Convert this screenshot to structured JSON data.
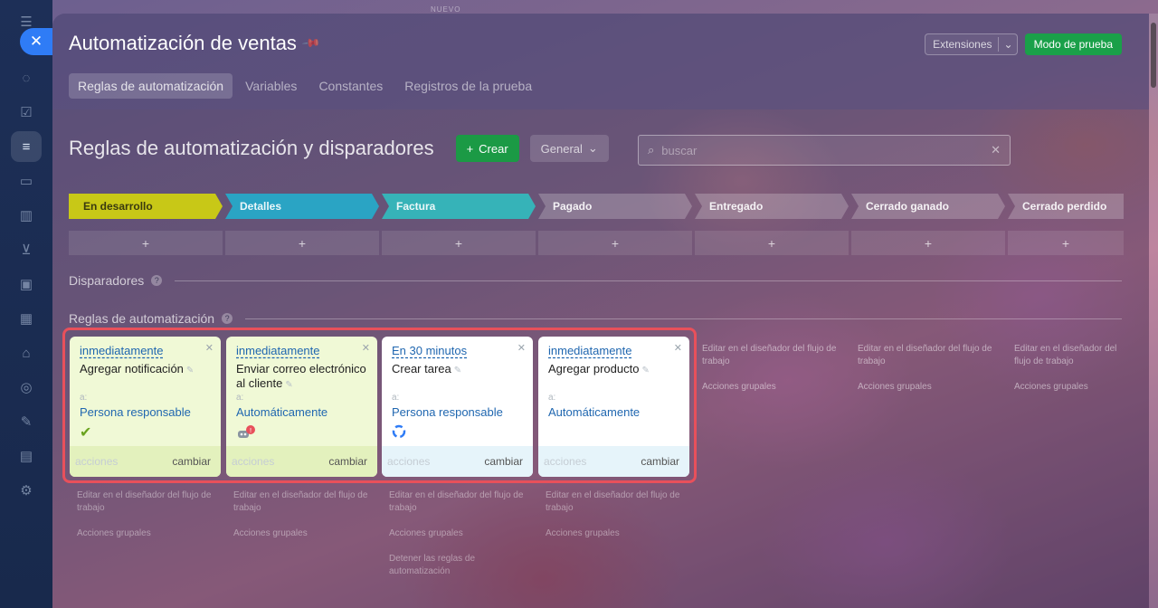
{
  "header": {
    "title": "Automatización de ventas",
    "extensions_label": "Extensiones",
    "test_mode_label": "Modo de prueba",
    "top_badge": "NUEVO"
  },
  "tabs": [
    {
      "label": "Reglas de automatización"
    },
    {
      "label": "Variables"
    },
    {
      "label": "Constantes"
    },
    {
      "label": "Registros de la prueba"
    }
  ],
  "main": {
    "title": "Reglas de automatización y disparadores",
    "create_label": "Crear",
    "general_label": "General",
    "search_placeholder": "buscar"
  },
  "stages": [
    {
      "label": "En desarrollo",
      "color": "#c8c817"
    },
    {
      "label": "Detalles",
      "color": "#2aa4c4"
    },
    {
      "label": "Factura",
      "color": "#36b3b8"
    },
    {
      "label": "Pagado",
      "color": "rgba(255,255,255,0.22)"
    },
    {
      "label": "Entregado",
      "color": "rgba(255,255,255,0.22)"
    },
    {
      "label": "Cerrado ganado",
      "color": "rgba(255,255,255,0.22)"
    },
    {
      "label": "Cerrado perdido",
      "color": "rgba(255,255,255,0.22)"
    }
  ],
  "add_symbol": "+",
  "sections": {
    "triggers": "Disparadores",
    "rules": "Reglas de automatización"
  },
  "cards": [
    {
      "when": "inmediatamente",
      "action": "Agregar notificación",
      "to_label": "a:",
      "to_value": "Persona responsable",
      "actions": "acciones",
      "change": "cambiar"
    },
    {
      "when": "inmediatamente",
      "action": "Enviar correo electrónico al cliente",
      "to_label": "a:",
      "to_value": "Automáticamente",
      "actions": "acciones",
      "change": "cambiar"
    },
    {
      "when": "En 30 minutos",
      "action": "Crear tarea",
      "to_label": "a:",
      "to_value": "Persona responsable",
      "actions": "acciones",
      "change": "cambiar"
    },
    {
      "when": "inmediatamente",
      "action": "Agregar producto",
      "to_label": "a:",
      "to_value": "Automáticamente",
      "actions": "acciones",
      "change": "cambiar"
    }
  ],
  "below_links": {
    "edit_designer": "Editar en el diseñador del flujo de trabajo",
    "group_actions": "Acciones grupales",
    "stop_rules": "Detener las reglas de automatización"
  }
}
